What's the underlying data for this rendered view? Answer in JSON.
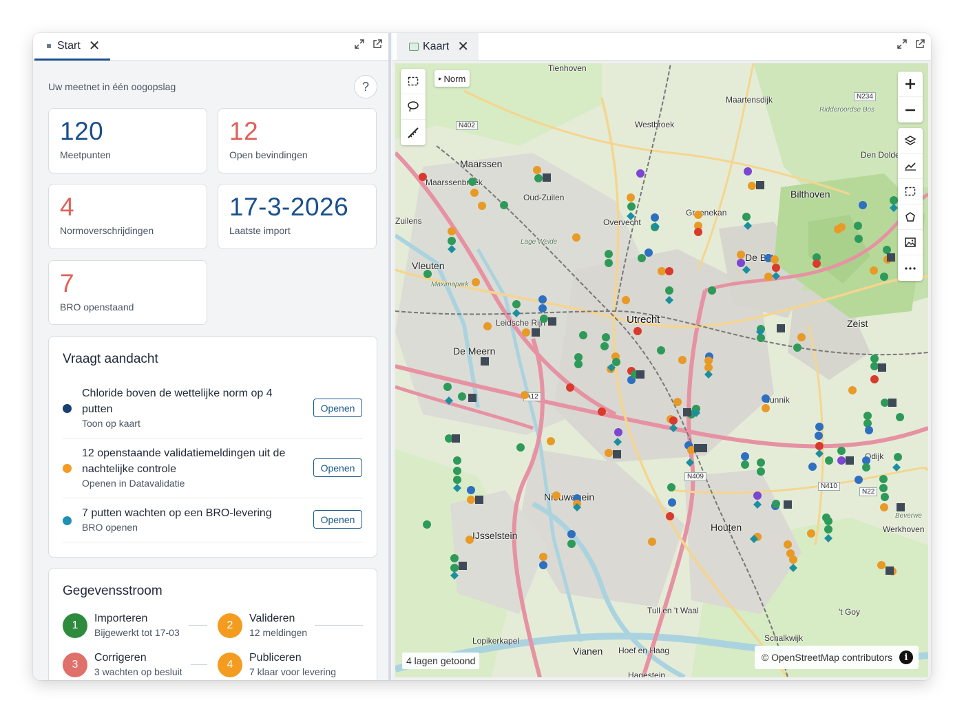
{
  "tabs": {
    "left": {
      "label": "Start"
    },
    "right": {
      "label": "Kaart"
    }
  },
  "start": {
    "subtitle": "Uw meetnet in één oogopslag",
    "help_label": "?",
    "stats": [
      {
        "value": "120",
        "label": "Meetpunten",
        "color": "#1a4f8b"
      },
      {
        "value": "12",
        "label": "Open bevindingen",
        "color": "#e0615a"
      },
      {
        "value": "4",
        "label": "Normoverschrijdingen",
        "color": "#e0615a"
      },
      {
        "value": "17-3-2026",
        "label": "Laatste import",
        "color": "#1a4f8b"
      },
      {
        "value": "7",
        "label": "BRO openstaand",
        "color": "#e0615a"
      }
    ],
    "attention": {
      "title": "Vraagt aandacht",
      "items": [
        {
          "title": "Chloride boven de wettelijke norm op 4 putten",
          "sub": "Toon op kaart",
          "button": "Openen",
          "dot_color": "#1a3f73"
        },
        {
          "title": "12 openstaande validatiemeldingen uit de nachtelijke controle",
          "sub": "Openen in Datavalidatie",
          "button": "Openen",
          "dot_color": "#f39c1f"
        },
        {
          "title": "7 putten wachten op een BRO-levering",
          "sub": "BRO openen",
          "button": "Openen",
          "dot_color": "#1f8fb5"
        }
      ]
    },
    "flow": {
      "title": "Gegevensstroom",
      "steps": [
        {
          "num": "1",
          "title": "Importeren",
          "sub": "Bijgewerkt tot 17-03",
          "color": "#2e8b3e"
        },
        {
          "num": "2",
          "title": "Valideren",
          "sub": "12 meldingen",
          "color": "#f39c1f"
        },
        {
          "num": "3",
          "title": "Corrigeren",
          "sub": "3 wachten op besluit",
          "color": "#e0706a"
        },
        {
          "num": "4",
          "title": "Publiceren",
          "sub": "7 klaar voor levering",
          "color": "#f39c1f"
        }
      ]
    }
  },
  "map": {
    "norm_label": "Norm",
    "layers_info": "4 lagen getoond",
    "attribution": "© OpenStreetMap contributors",
    "labels": {
      "tienhoven": "Tienhoven",
      "maartensdijk": "Maartensdijk",
      "westbroek": "Westbroek",
      "maarssen": "Maarssen",
      "maarssenbroek": "Maarssenbroek",
      "oud_zuilen": "Oud-Zuilen",
      "overvecht": "Overvecht",
      "groenekan": "Groenekan",
      "bilthoven": "Bilthoven",
      "den_dolder": "Den Dolder",
      "zuilens": "Zuilens",
      "vleuten": "Vleuten",
      "lage_weide": "Lage Weide",
      "maximapark": "Maximapark",
      "de_bilt": "De Bilt",
      "leidsche_rijn": "Leidsche Rijn",
      "utrecht": "Utrecht",
      "zeist": "Zeist",
      "de_meern": "De Meern",
      "bunnik": "Bunnik",
      "odijk": "Odijk",
      "nieuwegein": "Nieuwegein",
      "houten": "Houten",
      "ijsselstein": "IJsselstein",
      "werkhoven": "Werkhoven",
      "beverwe": "Beverwe",
      "t_goy": "'t Goy",
      "lopikerkapel": "Lopikerkapel",
      "vianen": "Vianen",
      "hoef_en_haag": "Hoef en Haag",
      "tull_en_t_waal": "Tull en 't Waal",
      "schalkwijk": "Schalkwijk",
      "hagestein": "Hagestein",
      "ridderoordse_bos": "Ridderoordse Bos"
    },
    "roads": {
      "n402": "N402",
      "n234": "N234",
      "a12": "A12",
      "n409": "N409",
      "n410": "N410",
      "n22": "N22"
    },
    "marker_colors": {
      "green": "#2e9a5a",
      "orange": "#e89a26",
      "blue": "#2f6fbf",
      "red": "#d93a2e",
      "purple": "#7b46d1",
      "teal": "#1b8fa0",
      "gray": "#3f4a59",
      "orangered": "#e8622a"
    }
  }
}
